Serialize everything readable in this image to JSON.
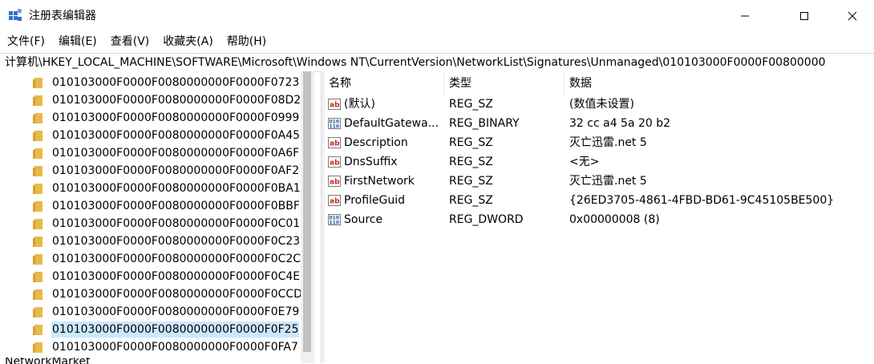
{
  "window": {
    "title": "注册表编辑器"
  },
  "menu": [
    "文件(F)",
    "编辑(E)",
    "查看(V)",
    "收藏夹(A)",
    "帮助(H)"
  ],
  "address": "计算机\\HKEY_LOCAL_MACHINE\\SOFTWARE\\Microsoft\\Windows NT\\CurrentVersion\\NetworkList\\Signatures\\Unmanaged\\010103000F0000F00800000",
  "tree": {
    "items": [
      "010103000F0000F0080000000F0000F0723",
      "010103000F0000F0080000000F0000F08D2",
      "010103000F0000F0080000000F0000F0999",
      "010103000F0000F0080000000F0000F0A45",
      "010103000F0000F0080000000F0000F0A6F",
      "010103000F0000F0080000000F0000F0AF2",
      "010103000F0000F0080000000F0000F0BA1",
      "010103000F0000F0080000000F0000F0BBF",
      "010103000F0000F0080000000F0000F0C01",
      "010103000F0000F0080000000F0000F0C23",
      "010103000F0000F0080000000F0000F0C2C",
      "010103000F0000F0080000000F0000F0C4E",
      "010103000F0000F0080000000F0000F0CCD",
      "010103000F0000F0080000000F0000F0E79",
      "010103000F0000F0080000000F0000F0F25",
      "010103000F0000F0080000000F0000F0FA7"
    ],
    "selected_index": 14,
    "partial_below": "NetworkMarket"
  },
  "list": {
    "headers": {
      "name": "名称",
      "type": "类型",
      "data": "数据"
    },
    "rows": [
      {
        "icon": "string-value-icon",
        "name": "(默认)",
        "type": "REG_SZ",
        "data": "(数值未设置)"
      },
      {
        "icon": "binary-value-icon",
        "name": "DefaultGatewa...",
        "type": "REG_BINARY",
        "data": "32 cc a4 5a 20 b2"
      },
      {
        "icon": "string-value-icon",
        "name": "Description",
        "type": "REG_SZ",
        "data": "灭亡迅雷.net 5"
      },
      {
        "icon": "string-value-icon",
        "name": "DnsSuffix",
        "type": "REG_SZ",
        "data": "<无>"
      },
      {
        "icon": "string-value-icon",
        "name": "FirstNetwork",
        "type": "REG_SZ",
        "data": "灭亡迅雷.net 5"
      },
      {
        "icon": "string-value-icon",
        "name": "ProfileGuid",
        "type": "REG_SZ",
        "data": "{26ED3705-4861-4FBD-BD61-9C45105BE500}"
      },
      {
        "icon": "binary-value-icon",
        "name": "Source",
        "type": "REG_DWORD",
        "data": "0x00000008 (8)"
      }
    ]
  },
  "colors": {
    "selection": "#cce8ff",
    "folder": "#e8b84a"
  }
}
